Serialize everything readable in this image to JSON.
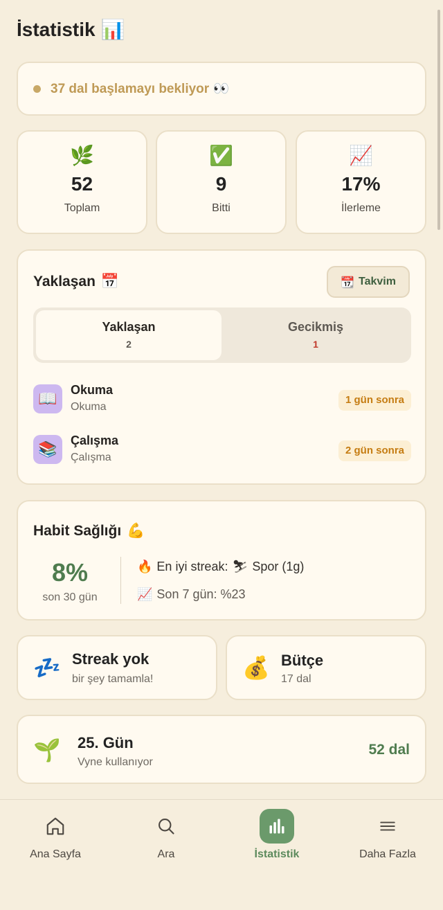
{
  "header": {
    "title": "İstatistik",
    "title_emoji": "📊"
  },
  "banner": {
    "text": "37 dal başlamayı bekliyor",
    "emoji": "👀",
    "dot_color": "#c8a867"
  },
  "stats": [
    {
      "icon": "🌿",
      "icon_name": "herb-icon",
      "value": "52",
      "label": "Toplam"
    },
    {
      "icon": "✅",
      "icon_name": "check-icon",
      "value": "9",
      "label": "Bitti"
    },
    {
      "icon": "📈",
      "icon_name": "chart-up-icon",
      "value": "17%",
      "label": "İlerleme"
    }
  ],
  "upcoming": {
    "title": "Yaklaşan",
    "title_emoji": "📅",
    "calendar_button": {
      "icon": "📆",
      "label": "Takvim"
    },
    "tabs": [
      {
        "label": "Yaklaşan",
        "count": "2"
      },
      {
        "label": "Gecikmiş",
        "count": "1"
      }
    ],
    "items": [
      {
        "icon": "📖",
        "name": "Okuma",
        "category": "Okuma",
        "due": "1 gün sonra"
      },
      {
        "icon": "📚",
        "name": "Çalışma",
        "category": "Çalışma",
        "due": "2 gün sonra"
      }
    ]
  },
  "habit": {
    "title": "Habit Sağlığı",
    "title_emoji": "💪",
    "percent": "8%",
    "period": "son 30 gün",
    "streak_icon": "🔥",
    "streak_text": "En iyi streak:",
    "streak_emoji": "⛷",
    "streak_value": "Spor (1g)",
    "week_icon": "📈",
    "week_text": "Son 7 gün: %23"
  },
  "streak_card": {
    "icon": "💤",
    "title": "Streak yok",
    "subtitle": "bir şey tamamla!"
  },
  "budget_card": {
    "icon": "💰",
    "title": "Bütçe",
    "subtitle": "17 dal"
  },
  "day_card": {
    "icon": "🌱",
    "title": "25. Gün",
    "subtitle": "Vyne kullanıyor",
    "value": "52 dal"
  },
  "nav": [
    {
      "label": "Ana Sayfa",
      "icon": "home-icon",
      "active": false
    },
    {
      "label": "Ara",
      "icon": "search-icon",
      "active": false
    },
    {
      "label": "İstatistik",
      "icon": "stats-icon",
      "active": true
    },
    {
      "label": "Daha Fazla",
      "icon": "menu-icon",
      "active": false
    }
  ],
  "colors": {
    "background": "#f6eedd",
    "card": "#fffaf0",
    "accent_green": "#4f7c4f",
    "nav_active": "#6b9a6b",
    "overdue_red": "#c0392b",
    "due_orange": "#c57c12"
  }
}
